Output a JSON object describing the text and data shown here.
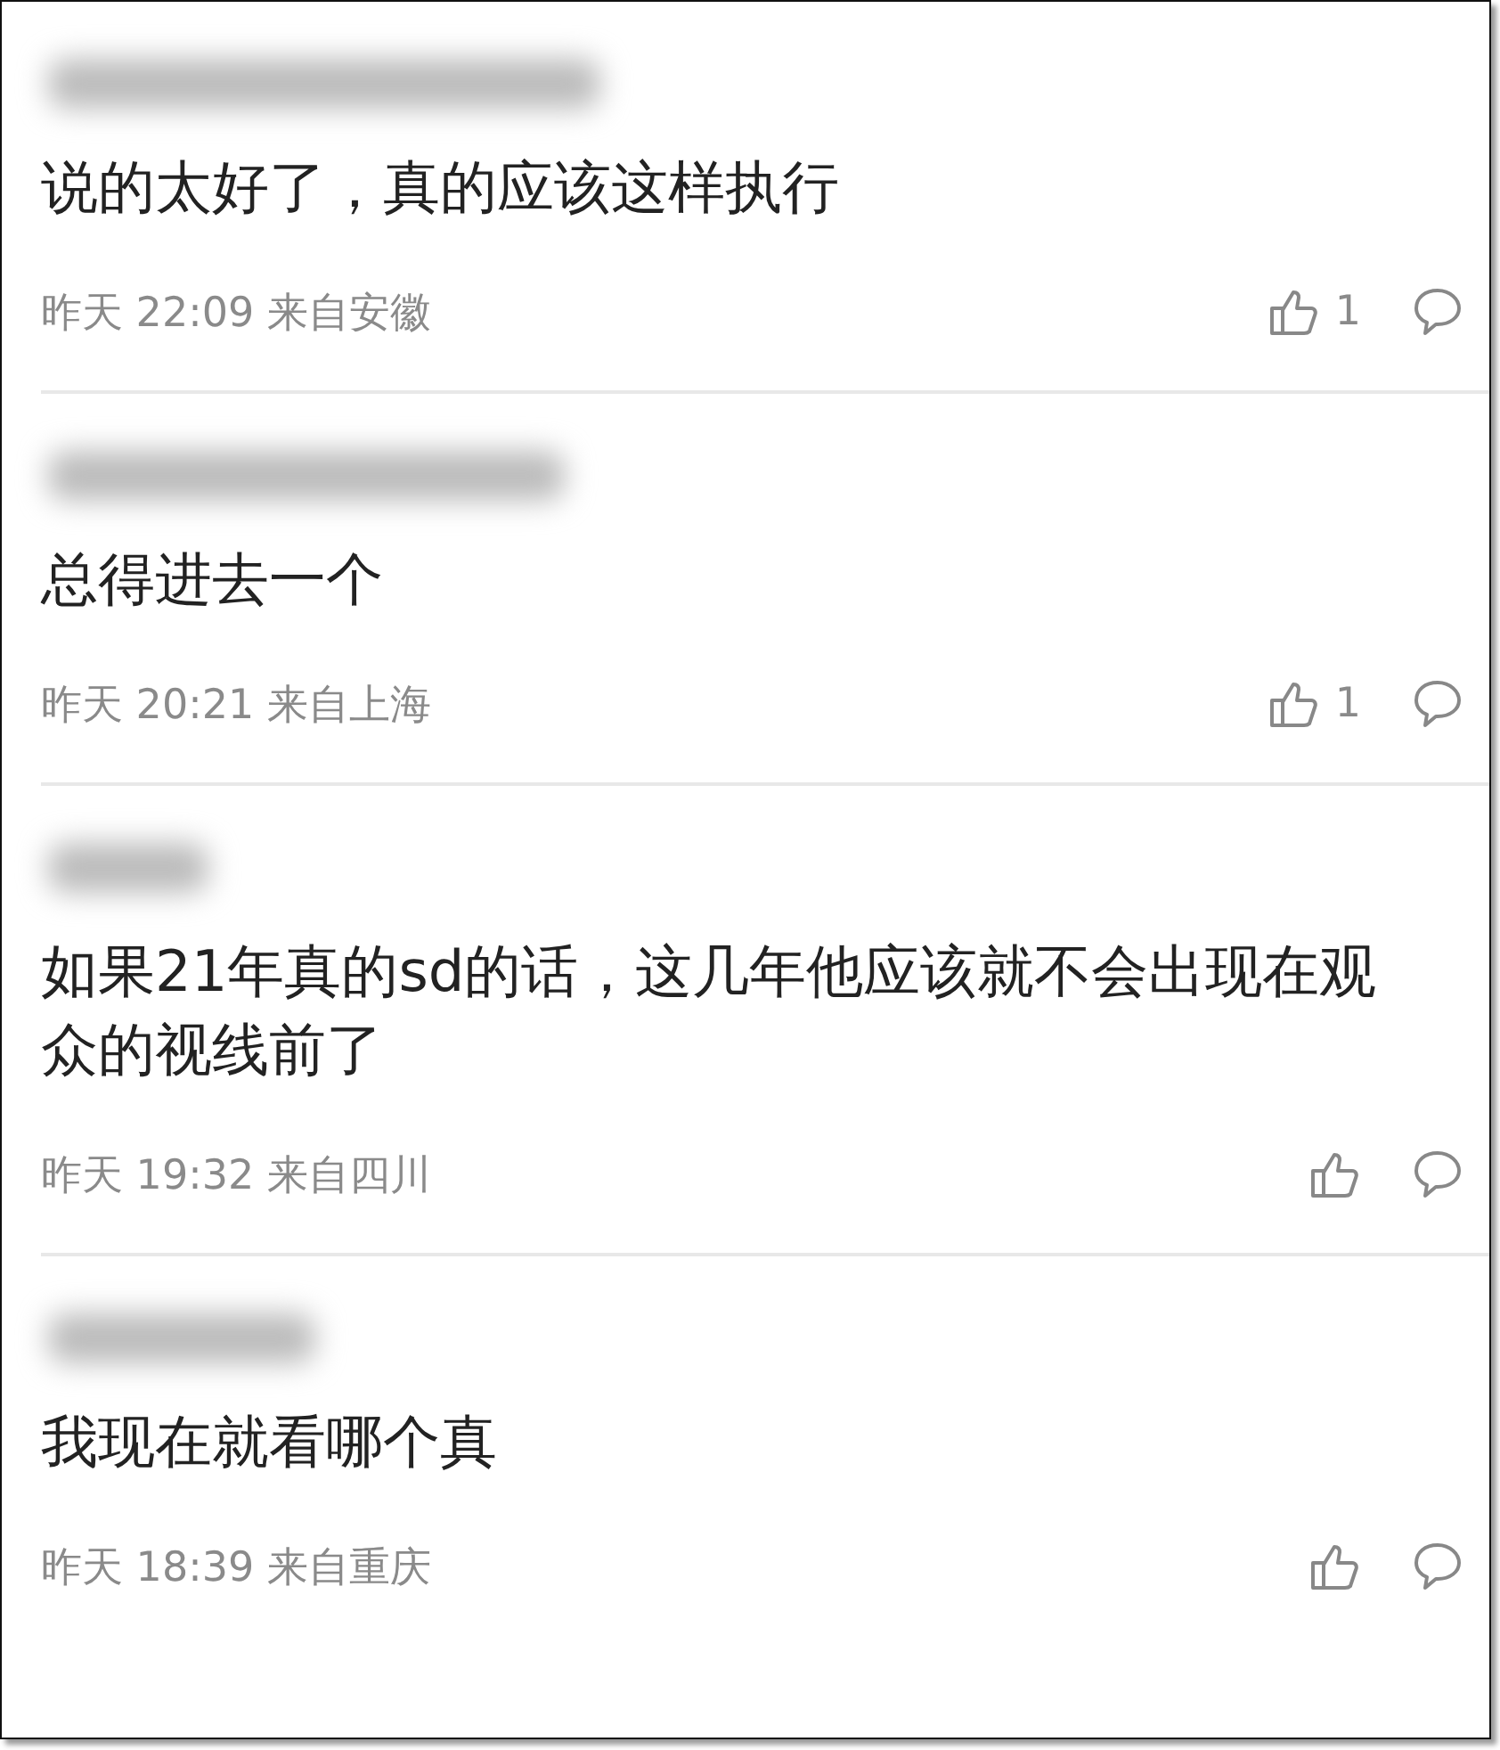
{
  "comments": [
    {
      "text": "说的太好了，真的应该这样执行",
      "meta": "昨天 22:09 来自安徽",
      "likes": "1"
    },
    {
      "text": "总得进去一个",
      "meta": "昨天 20:21 来自上海",
      "likes": "1"
    },
    {
      "text": "如果21年真的sd的话，这几年他应该就不会出现在观众的视线前了",
      "meta": "昨天 19:32 来自四川"
    },
    {
      "text": "我现在就看哪个真",
      "meta": "昨天 18:39 来自重庆"
    }
  ]
}
